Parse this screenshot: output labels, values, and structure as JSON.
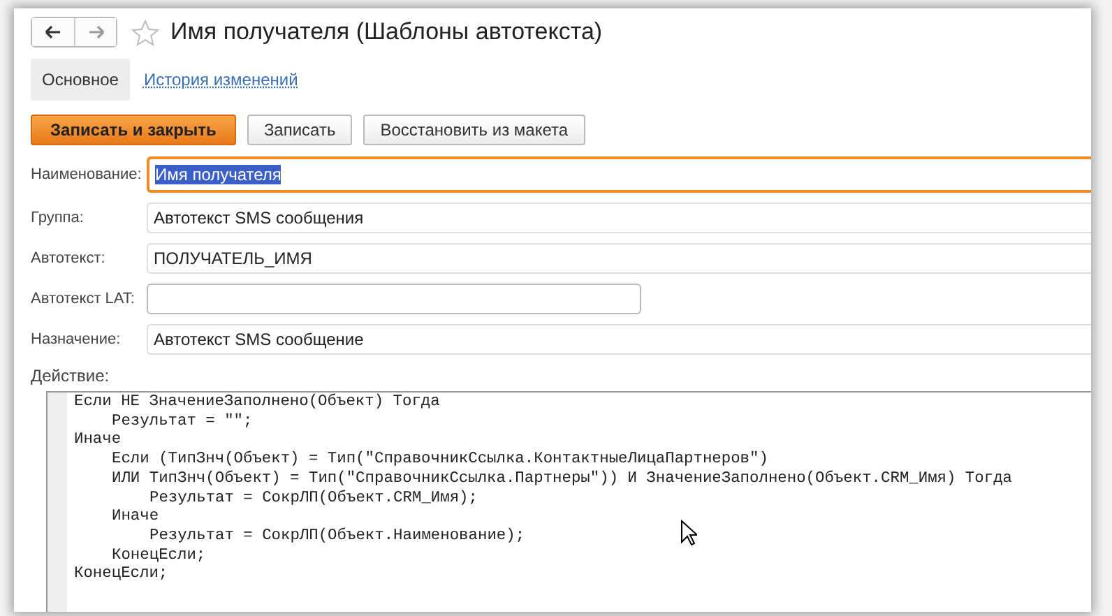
{
  "window": {
    "title": "Имя получателя (Шаблоны автотекста)",
    "favorite": false
  },
  "tabs": [
    {
      "label": "Основное",
      "selected": true
    },
    {
      "label": "История изменений",
      "selected": false
    }
  ],
  "buttons": [
    {
      "label": "Записать и закрыть",
      "kind": "primary"
    },
    {
      "label": "Записать",
      "kind": "normal"
    },
    {
      "label": "Восстановить из макета",
      "kind": "normal"
    }
  ],
  "fields": [
    {
      "label": "Наименование:",
      "value": "Имя получателя",
      "focused": true,
      "wide": true
    },
    {
      "label": "Группа:",
      "value": "Автотекст SMS сообщения",
      "focused": false,
      "wide": true
    },
    {
      "label": "Автотекст:",
      "value": "ПОЛУЧАТЕЛЬ_ИМЯ",
      "focused": false,
      "wide": true
    },
    {
      "label": "Автотекст LAT:",
      "focused": false,
      "wide": false
    },
    {
      "label": "Назначение:",
      "value": "Автотекст SMS сообщение",
      "focused": false,
      "wide": true
    }
  ],
  "action": {
    "label": "Действие:",
    "code": [
      {
        "text": "Если НЕ ЗначениеЗаполнено(Объект) Тогда",
        "children": [
          {
            "text": "Результат = \"\";"
          }
        ]
      },
      {
        "text": "Иначе",
        "children": [
          {
            "text": "Если (ТипЗнч(Объект) = Тип(\"СправочникСсылка.КонтактныеЛицаПартнеров\")"
          },
          {
            "text": "ИЛИ ТипЗнч(Объект) = Тип(\"СправочникСсылка.Партнеры\")) И ЗначениеЗаполнено(Объект.CRM_Имя) Тогда",
            "children": [
              {
                "text": "Результат = СокрЛП(Объект.CRM_Имя);"
              }
            ]
          },
          {
            "text": "Иначе",
            "children": [
              {
                "text": "Результат = СокрЛП(Объект.Наименование);"
              }
            ]
          },
          {
            "text": "КонецЕсли;"
          }
        ]
      },
      {
        "text": "КонецЕсли;"
      }
    ]
  }
}
